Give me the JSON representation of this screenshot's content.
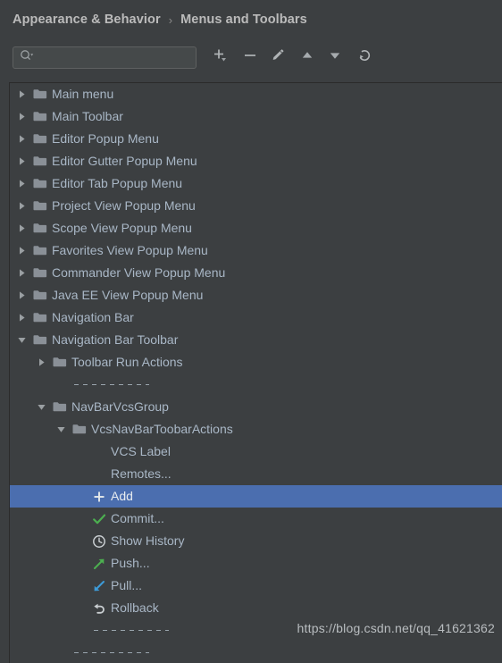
{
  "breadcrumb": {
    "parent": "Appearance & Behavior",
    "separator": "›",
    "current": "Menus and Toolbars"
  },
  "toolbar": {
    "search": {
      "value": "",
      "placeholder": "",
      "icon": "search-icon"
    },
    "buttons": [
      {
        "name": "add-button",
        "icon": "plus-icon",
        "label": "Add"
      },
      {
        "name": "remove-button",
        "icon": "minus-icon",
        "label": "Remove"
      },
      {
        "name": "edit-button",
        "icon": "pencil-icon",
        "label": "Edit"
      },
      {
        "name": "move-up-button",
        "icon": "triangle-up-icon",
        "label": "Move Up"
      },
      {
        "name": "move-down-button",
        "icon": "triangle-down-icon",
        "label": "Move Down"
      },
      {
        "name": "restore-button",
        "icon": "restore-arrow-icon",
        "label": "Restore"
      }
    ],
    "highlight_color": "#f00000"
  },
  "colors": {
    "background": "#3c3f41",
    "text": "#a9b7c6",
    "selection": "#4b6eaf",
    "folder": "#8a9097",
    "green": "#4caf50",
    "blue": "#3d9bd8"
  },
  "tree": {
    "rows": [
      {
        "type": "folder",
        "indent": 0,
        "expander": "collapsed",
        "label": "Main menu"
      },
      {
        "type": "folder",
        "indent": 0,
        "expander": "collapsed",
        "label": "Main Toolbar"
      },
      {
        "type": "folder",
        "indent": 0,
        "expander": "collapsed",
        "label": "Editor Popup Menu"
      },
      {
        "type": "folder",
        "indent": 0,
        "expander": "collapsed",
        "label": "Editor Gutter Popup Menu"
      },
      {
        "type": "folder",
        "indent": 0,
        "expander": "collapsed",
        "label": "Editor Tab Popup Menu"
      },
      {
        "type": "folder",
        "indent": 0,
        "expander": "collapsed",
        "label": "Project View Popup Menu"
      },
      {
        "type": "folder",
        "indent": 0,
        "expander": "collapsed",
        "label": "Scope View Popup Menu"
      },
      {
        "type": "folder",
        "indent": 0,
        "expander": "collapsed",
        "label": "Favorites View Popup Menu"
      },
      {
        "type": "folder",
        "indent": 0,
        "expander": "collapsed",
        "label": "Commander View Popup Menu"
      },
      {
        "type": "folder",
        "indent": 0,
        "expander": "collapsed",
        "label": "Java EE View Popup Menu"
      },
      {
        "type": "folder",
        "indent": 0,
        "expander": "collapsed",
        "label": "Navigation Bar"
      },
      {
        "type": "folder",
        "indent": 0,
        "expander": "expanded",
        "label": "Navigation Bar Toolbar"
      },
      {
        "type": "folder",
        "indent": 1,
        "expander": "collapsed",
        "label": "Toolbar Run Actions"
      },
      {
        "type": "separator",
        "indent": 2
      },
      {
        "type": "folder",
        "indent": 1,
        "expander": "expanded",
        "label": "NavBarVcsGroup"
      },
      {
        "type": "folder",
        "indent": 2,
        "expander": "expanded",
        "label": "VcsNavBarToobarActions"
      },
      {
        "type": "action",
        "indent": 3,
        "icon": "none",
        "label": "VCS Label"
      },
      {
        "type": "action",
        "indent": 3,
        "icon": "none",
        "label": "Remotes..."
      },
      {
        "type": "action",
        "indent": 3,
        "icon": "plus-icon",
        "label": "Add",
        "selected": true
      },
      {
        "type": "action",
        "indent": 3,
        "icon": "check-icon",
        "label": "Commit..."
      },
      {
        "type": "action",
        "indent": 3,
        "icon": "clock-icon",
        "label": "Show History"
      },
      {
        "type": "action",
        "indent": 3,
        "icon": "arrow-up-right-icon",
        "label": "Push..."
      },
      {
        "type": "action",
        "indent": 3,
        "icon": "arrow-down-left-icon",
        "label": "Pull..."
      },
      {
        "type": "action",
        "indent": 3,
        "icon": "rollback-icon",
        "label": "Rollback"
      },
      {
        "type": "separator",
        "indent": 3
      },
      {
        "type": "separator",
        "indent": 2
      }
    ]
  },
  "watermark": {
    "text": "https://blog.csdn.net/qq_41621362"
  }
}
